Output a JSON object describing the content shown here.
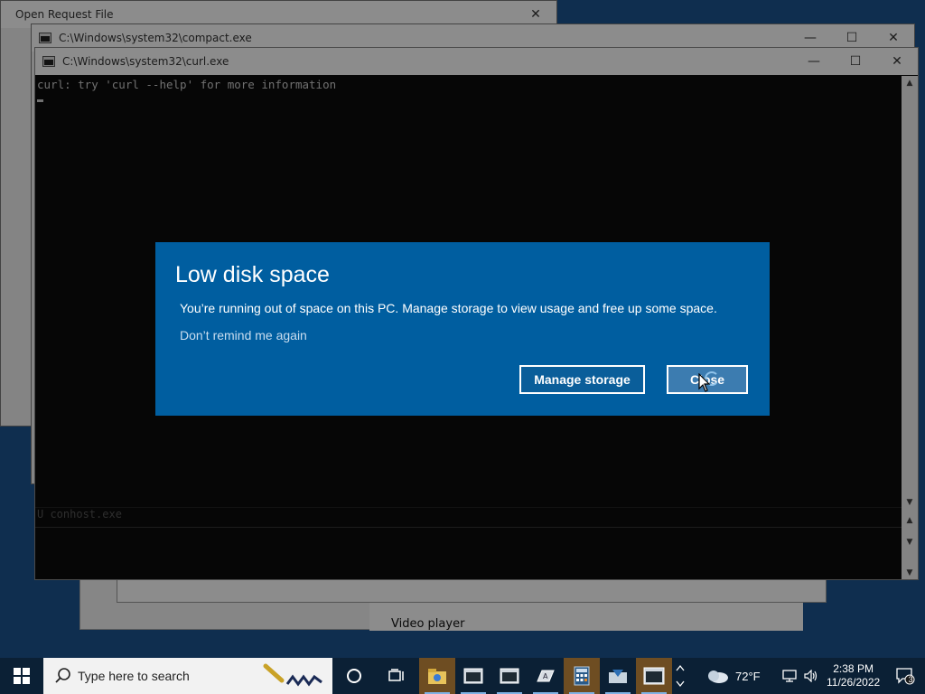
{
  "windows": {
    "open_request": {
      "title": "Open Request File",
      "close": "✕"
    },
    "compact": {
      "title": "C:\\Windows\\system32\\compact.exe",
      "min": "—",
      "max": "☐",
      "close": "✕"
    },
    "curl": {
      "title": "C:\\Windows\\system32\\curl.exe",
      "min": "—",
      "max": "☐",
      "close": "✕",
      "console_line": "curl: try 'curl --help' for more information",
      "process_row": "U conhost.exe"
    },
    "video": {
      "label": "Video player"
    }
  },
  "dialog": {
    "title": "Low disk space",
    "message": "You’re running out of space on this PC. Manage storage to view usage and free up some space.",
    "dont_remind": "Don’t remind me again",
    "manage_button": "Manage storage",
    "close_button": "Close"
  },
  "taskbar": {
    "search_placeholder": "Type here to search",
    "weather": "72°F",
    "time": "2:38 PM",
    "date": "11/26/2022",
    "notification_count": "3",
    "pinned_icons": [
      "task-view-icon",
      "file-explorer-icon",
      "cmd-icon",
      "cmd-icon",
      "language-bar-icon",
      "calculator-icon",
      "mail-icon",
      "cmd-icon"
    ]
  },
  "colors": {
    "dialog_bg": "#005ea0",
    "taskbar_bg": "#0b2035",
    "console_bg": "#0c0c0c"
  }
}
